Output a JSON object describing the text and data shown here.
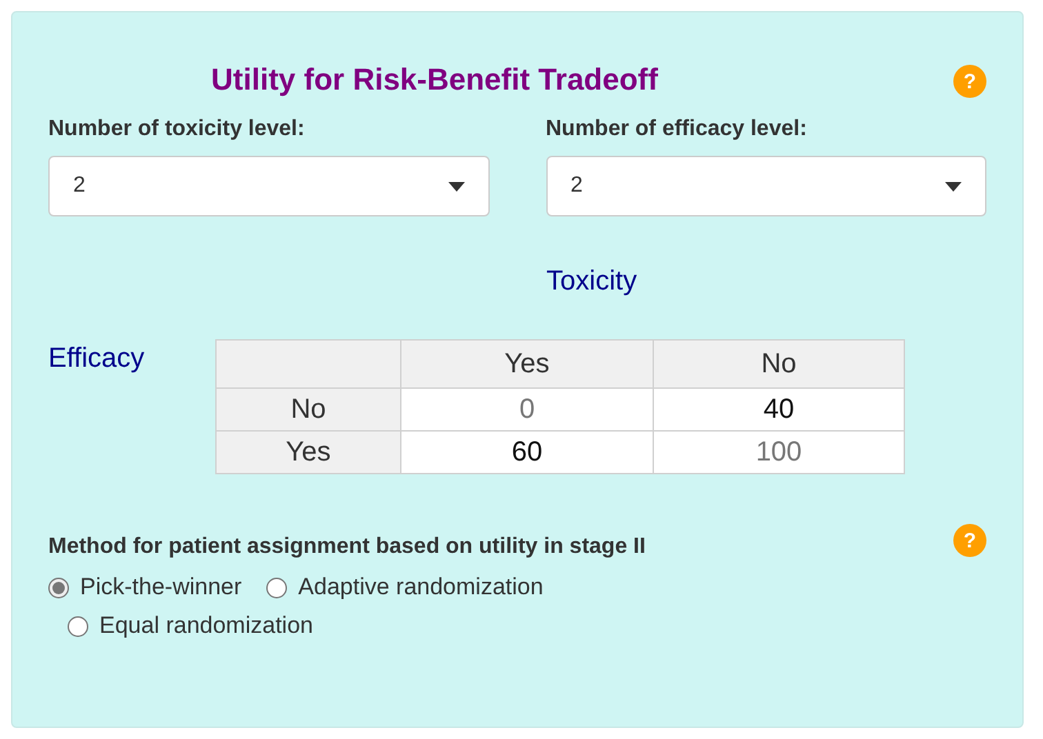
{
  "title": "Utility for Risk-Benefit Tradeoff",
  "title_help": "?",
  "selects": [
    {
      "label": "Number of toxicity level:",
      "value": "2"
    },
    {
      "label": "Number of efficacy level:",
      "value": "2"
    }
  ],
  "table": {
    "column_title": "Toxicity",
    "row_title": "Efficacy",
    "columns": [
      "Yes",
      "No"
    ],
    "rows": [
      {
        "label": "No",
        "cells": [
          {
            "value": "0",
            "fixed": true
          },
          {
            "value": "40",
            "fixed": false
          }
        ]
      },
      {
        "label": "Yes",
        "cells": [
          {
            "value": "60",
            "fixed": false
          },
          {
            "value": "100",
            "fixed": true
          }
        ]
      }
    ]
  },
  "method": {
    "label": "Method for patient assignment based on utility in stage II",
    "help": "?",
    "options": [
      {
        "label": "Pick-the-winner",
        "selected": true
      },
      {
        "label": "Adaptive randomization",
        "selected": false
      },
      {
        "label": "Equal randomization",
        "selected": false
      }
    ]
  }
}
